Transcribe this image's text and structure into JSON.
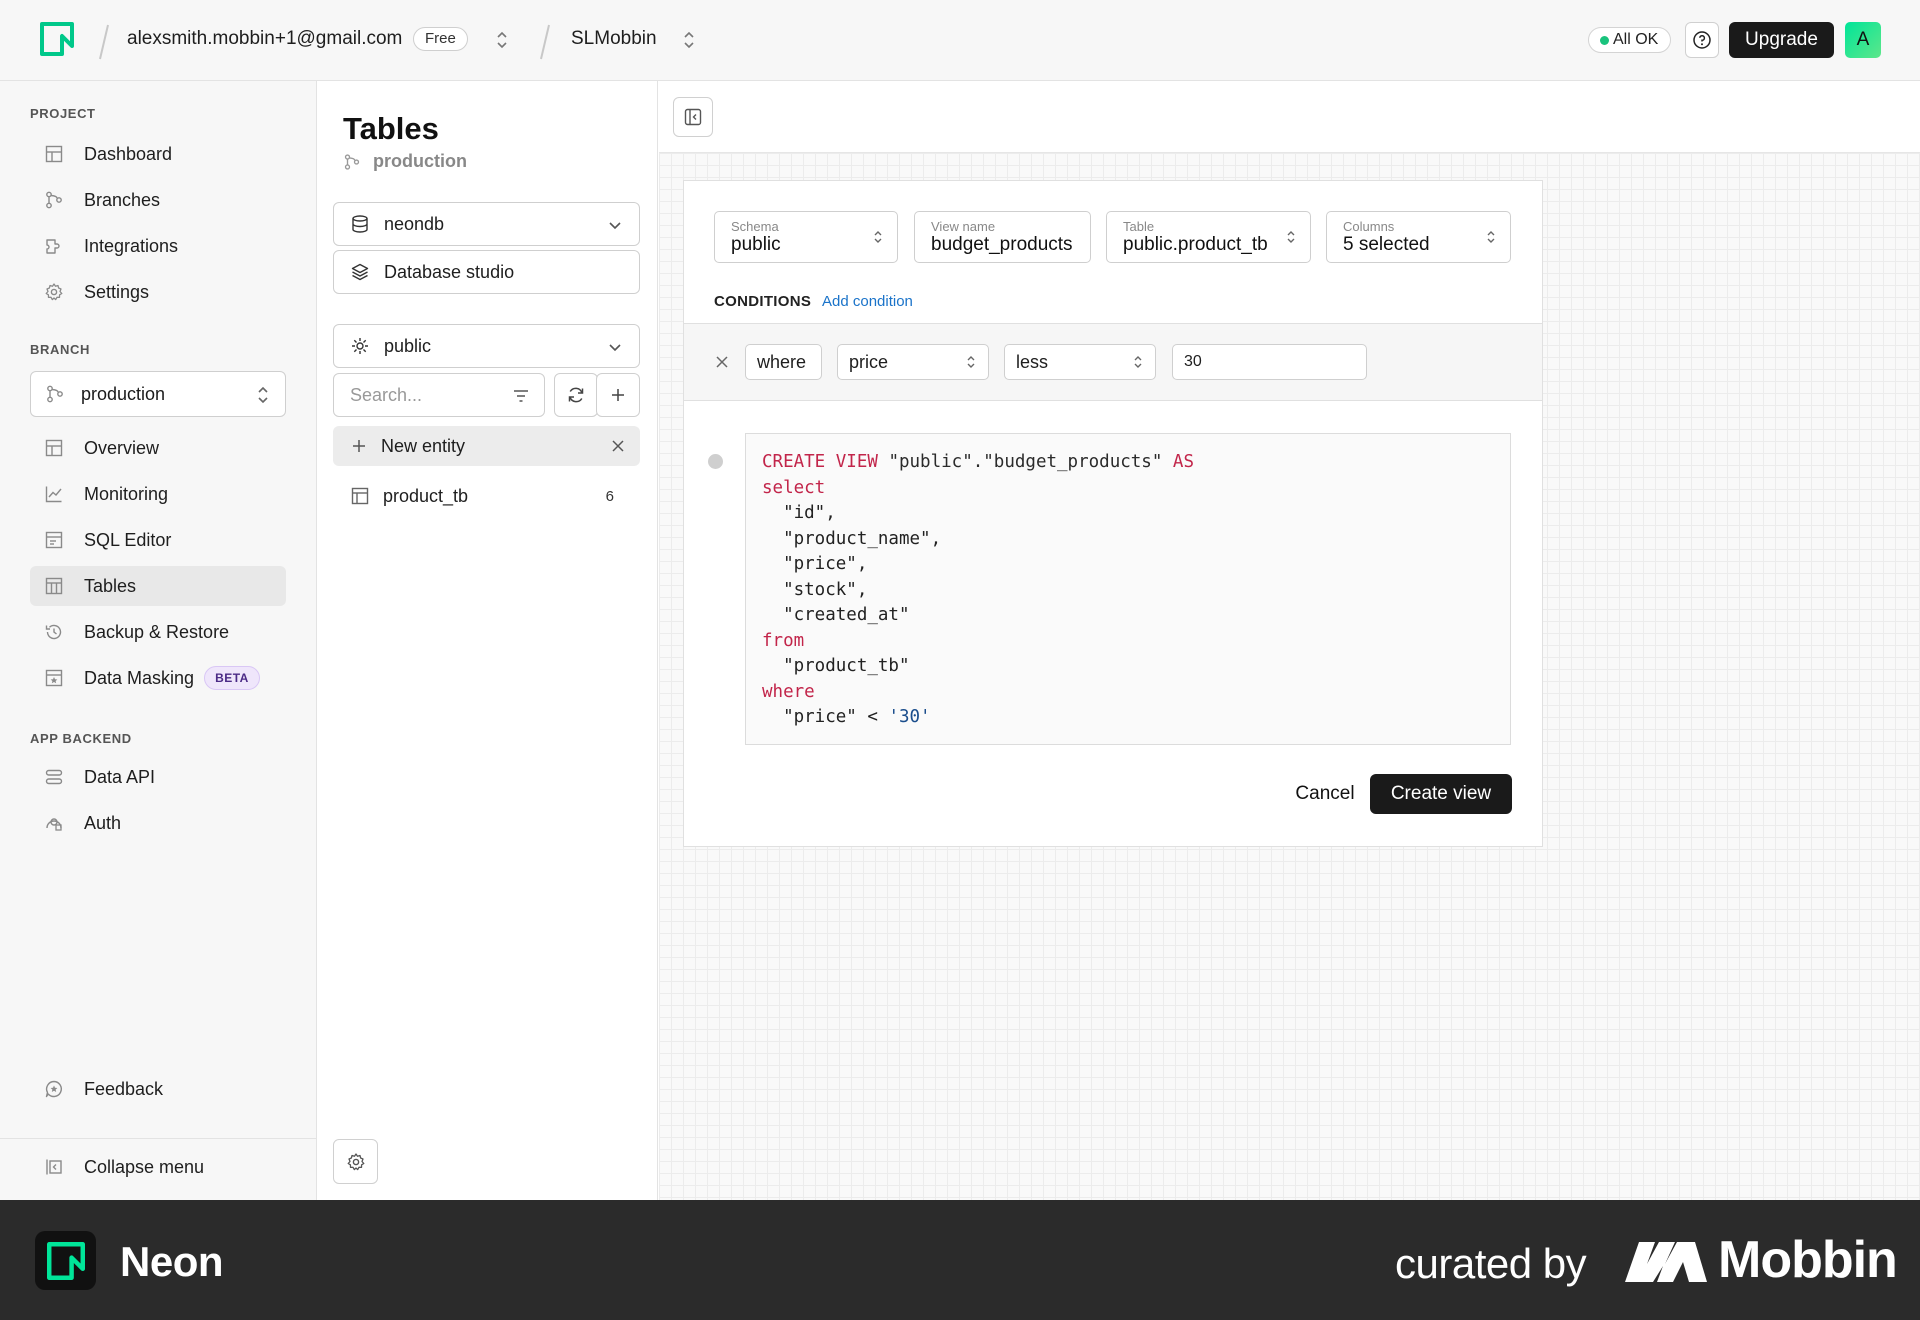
{
  "topbar": {
    "account_email": "alexsmith.mobbin+1@gmail.com",
    "plan_badge": "Free",
    "project_name": "SLMobbin",
    "status": "All OK",
    "upgrade_label": "Upgrade",
    "avatar_initial": "A"
  },
  "sidebar": {
    "project_label": "PROJECT",
    "project_items": [
      {
        "label": "Dashboard",
        "icon": "dashboard-icon"
      },
      {
        "label": "Branches",
        "icon": "branches-icon"
      },
      {
        "label": "Integrations",
        "icon": "integrations-icon"
      },
      {
        "label": "Settings",
        "icon": "gear-icon"
      }
    ],
    "branch_label": "BRANCH",
    "branch_selected": "production",
    "branch_items": [
      {
        "label": "Overview",
        "icon": "overview-icon"
      },
      {
        "label": "Monitoring",
        "icon": "chart-icon"
      },
      {
        "label": "SQL Editor",
        "icon": "sql-editor-icon"
      },
      {
        "label": "Tables",
        "icon": "table-icon",
        "active": true
      },
      {
        "label": "Backup & Restore",
        "icon": "history-icon"
      },
      {
        "label": "Data Masking",
        "icon": "mask-icon",
        "badge": "BETA"
      }
    ],
    "app_backend_label": "APP BACKEND",
    "backend_items": [
      {
        "label": "Data API",
        "icon": "api-icon"
      },
      {
        "label": "Auth",
        "icon": "auth-icon"
      }
    ],
    "feedback_label": "Feedback",
    "collapse_label": "Collapse menu"
  },
  "tables_panel": {
    "title": "Tables",
    "branch": "production",
    "database": "neondb",
    "studio_label": "Database studio",
    "schema": "public",
    "search_placeholder": "Search...",
    "new_entity_label": "New entity",
    "tables": [
      {
        "name": "product_tb",
        "count": "6"
      }
    ]
  },
  "view_form": {
    "schema_label": "Schema",
    "schema_value": "public",
    "view_name_label": "View name",
    "view_name_value": "budget_products",
    "table_label": "Table",
    "table_value": "public.product_tb",
    "columns_label": "Columns",
    "columns_value": "5 selected",
    "conditions_label": "CONDITIONS",
    "add_condition_label": "Add condition",
    "condition": {
      "clause": "where",
      "column": "price",
      "operator": "less",
      "value": "30"
    },
    "sql": {
      "line1_kw1": "CREATE VIEW",
      "line1_name": " \"public\".\"budget_products\" ",
      "line1_kw2": "AS",
      "select_kw": "select",
      "columns": [
        "  \"id\",",
        "  \"product_name\",",
        "  \"price\",",
        "  \"stock\",",
        "  \"created_at\""
      ],
      "from_kw": "from",
      "from_table": "  \"product_tb\"",
      "where_kw": "where",
      "where_left": "  \"price\" < ",
      "where_value": "'30'"
    },
    "cancel_label": "Cancel",
    "create_label": "Create view"
  },
  "banner": {
    "app_name": "Neon",
    "curated_by": "curated by",
    "brand": "Mobbin"
  },
  "colors": {
    "accent_green": "#00e599",
    "keyword_red": "#c2254a",
    "link_blue": "#1a73c9",
    "dark_button": "#1a1a1a"
  }
}
